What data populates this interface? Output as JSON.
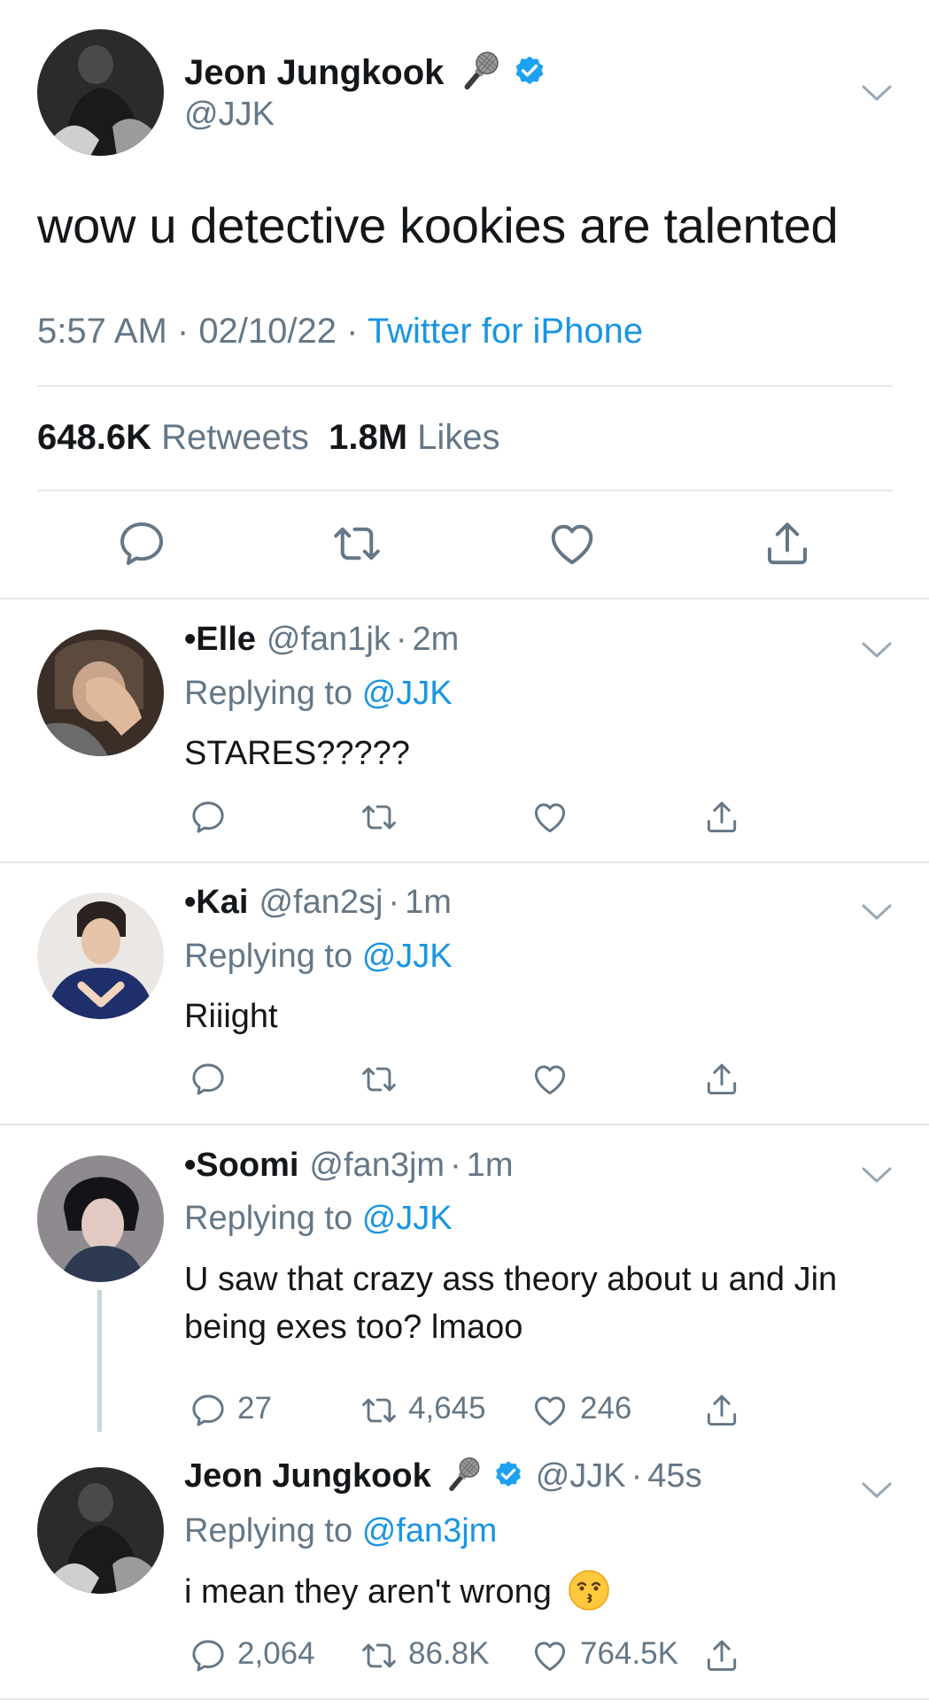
{
  "main_tweet": {
    "name": "Jeon Jungkook",
    "handle": "@JJK",
    "text": "wow u detective kookies are talented",
    "time": "5:57 AM",
    "sep1": " · ",
    "date": "02/10/22",
    "sep2": " · ",
    "source": "Twitter for iPhone",
    "retweets_count": "648.6K",
    "retweets_label": "Retweets",
    "likes_count": "1.8M",
    "likes_label": "Likes"
  },
  "replies": [
    {
      "name": "•Elle",
      "handle": "@fan1jk",
      "dot": "·",
      "time": "2m",
      "replying_label": "Replying to",
      "replying_to": "@JJK",
      "text": "STARES?????"
    },
    {
      "name": "•Kai",
      "handle": "@fan2sj",
      "dot": "·",
      "time": "1m",
      "replying_label": "Replying to",
      "replying_to": "@JJK",
      "text": "Riiight"
    },
    {
      "name": "•Soomi",
      "handle": "@fan3jm",
      "dot": "·",
      "time": "1m",
      "replying_label": "Replying to",
      "replying_to": "@JJK",
      "text": "U saw that crazy ass theory about u and Jin being exes too? lmaoo",
      "replies": "27",
      "retweets": "4,645",
      "likes": "246"
    },
    {
      "name": "Jeon Jungkook",
      "handle": "@JJK",
      "dot": "·",
      "time": "45s",
      "replying_label": "Replying to",
      "replying_to": "@fan3jm",
      "text": "i mean they aren't wrong",
      "emoji": "kissing-face-emoji",
      "replies": "2,064",
      "retweets": "86.8K",
      "likes": "764.5K"
    }
  ],
  "colors": {
    "link": "#1b95e0",
    "secondary": "#657786",
    "divider": "#e1e8ed",
    "verified": "#1da1f2",
    "icon": "#657786"
  },
  "icons": [
    "reply-icon",
    "retweet-icon",
    "like-icon",
    "share-icon",
    "chevron-down-icon",
    "verified-badge-icon",
    "microphone-emoji-icon"
  ]
}
